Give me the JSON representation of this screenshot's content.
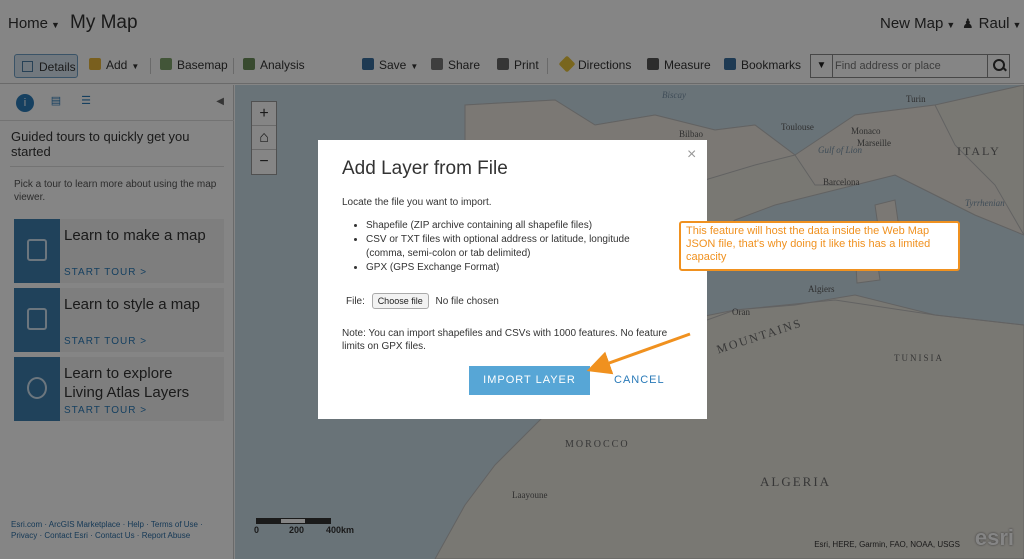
{
  "header": {
    "home_label": "Home",
    "map_title": "My Map",
    "new_map_label": "New Map",
    "user_label": "Raul"
  },
  "toolbar": {
    "details": "Details",
    "add": "Add",
    "basemap": "Basemap",
    "analysis": "Analysis",
    "save": "Save",
    "share": "Share",
    "print": "Print",
    "directions": "Directions",
    "measure": "Measure",
    "bookmarks": "Bookmarks",
    "search_placeholder": "Find address or place"
  },
  "panel": {
    "title": "Guided tours to quickly get you started",
    "description": "Pick a tour to learn more about using the map viewer.",
    "tours": [
      {
        "title": "Learn to make a map",
        "cta": "START TOUR >"
      },
      {
        "title": "Learn to style a map",
        "cta": "START TOUR >"
      },
      {
        "title": "Learn to explore Living Atlas Layers",
        "cta": "START TOUR >"
      }
    ],
    "footer": "Esri.com · ArcGIS Marketplace · Help · Terms of Use · Privacy · Contact Esri · Contact Us · Report Abuse"
  },
  "map": {
    "labels": {
      "biscay": "Biscay",
      "bilbao": "Bilbao",
      "toulouse": "Toulouse",
      "monaco": "Monaco",
      "marseille": "Marseille",
      "turin": "Turin",
      "italy": "ITALY",
      "barcelona": "Barcelona",
      "tyrrhenian": "Tyrrhenian",
      "algiers": "Algiers",
      "oran": "Oran",
      "mountains": "MOUNTAINS",
      "tunisia": "TUNISIA",
      "morocco": "MOROCCO",
      "algeria": "ALGERIA",
      "laayoune": "Laayoune",
      "gulf_of_lion": "Gulf of Lion"
    },
    "scale": {
      "zero": "0",
      "mid": "200",
      "end": "400km"
    },
    "attribution": "Esri, HERE, Garmin, FAO, NOAA, USGS",
    "logo_text": "esri"
  },
  "dialog": {
    "title": "Add Layer from File",
    "close_glyph": "×",
    "intro": "Locate the file you want to import.",
    "formats": [
      "Shapefile (ZIP archive containing all shapefile files)",
      "CSV or TXT files with optional address or latitude, longitude (comma, semi-colon or tab delimited)",
      "GPX (GPS Exchange Format)"
    ],
    "file_label": "File:",
    "choose_file": "Choose file",
    "no_file": "No file chosen",
    "note": "Note: You can import shapefiles and CSVs with 1000 features. No feature limits on GPX files.",
    "import_label": "IMPORT LAYER",
    "cancel_label": "CANCEL"
  },
  "callout": {
    "text": "This feature will host the data inside the Web Map JSON file, that's why doing it like this has a limited capacity"
  },
  "colors": {
    "accent": "#2b7bb9",
    "import_button": "#57a6d6",
    "callout": "#f0911f"
  }
}
